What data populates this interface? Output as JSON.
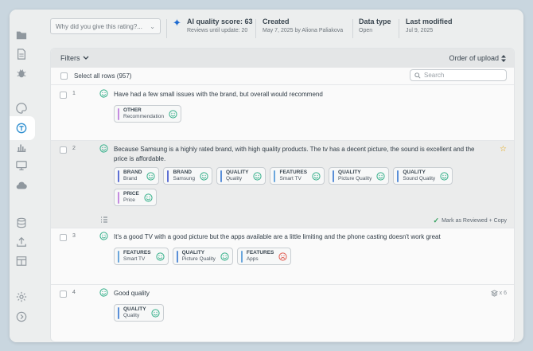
{
  "header": {
    "rating_placeholder": "Why did you give this rating?...",
    "ai_score_label": "AI quality score: 63",
    "ai_score_sub": "Reviews until update: 20",
    "created_label": "Created",
    "created_value": "May 7, 2025 by Aliona Paliakova",
    "data_type_label": "Data type",
    "data_type_value": "Open",
    "modified_label": "Last modified",
    "modified_value": "Jul 9, 2025"
  },
  "toolbar": {
    "filters_label": "Filters",
    "order_label": "Order of upload",
    "select_all_label": "Select all rows (957)",
    "search_placeholder": "Search"
  },
  "sidebar": {
    "items": [
      "folder-icon",
      "document-icon",
      "bug-icon",
      "palette-icon",
      "text-analysis-icon",
      "bar-chart-icon",
      "monitor-icon",
      "cloud-icon",
      "database-icon",
      "upload-icon",
      "table-icon",
      "settings-icon",
      "expand-icon"
    ],
    "active_index": 4
  },
  "colors": {
    "positive": "#35b08a",
    "negative": "#e05a4f",
    "bar_other": "#c48ce0",
    "bar_brand": "#5d6fd4",
    "bar_quality": "#5a8fd8",
    "bar_features": "#6aa6dc",
    "bar_price": "#c48ce0",
    "star": "#e5a200",
    "accent": "#2f8fd0"
  },
  "rows": [
    {
      "num": "1",
      "text": "Have had a few small issues with the brand, but overall would recommend",
      "tags": [
        {
          "cat": "OTHER",
          "sub": "Recommendation",
          "sentiment": "positive"
        }
      ]
    },
    {
      "num": "2",
      "text": "Because Samsung is a highly rated brand, with high quality products. The tv has a decent picture, the sound is excellent and the price is affordable.",
      "tags": [
        {
          "cat": "BRAND",
          "sub": "Brand",
          "sentiment": "positive"
        },
        {
          "cat": "BRAND",
          "sub": "Samsung",
          "sentiment": "positive"
        },
        {
          "cat": "QUALITY",
          "sub": "Quality",
          "sentiment": "positive"
        },
        {
          "cat": "FEATURES",
          "sub": "Smart TV",
          "sentiment": "positive"
        },
        {
          "cat": "QUALITY",
          "sub": "Picture Quality",
          "sentiment": "positive"
        },
        {
          "cat": "QUALITY",
          "sub": "Sound Quality",
          "sentiment": "positive"
        },
        {
          "cat": "PRICE",
          "sub": "Price",
          "sentiment": "positive"
        }
      ],
      "action_label": "Mark as Reviewed + Copy"
    },
    {
      "num": "3",
      "text": "It's a good TV with a good picture but the apps available are a little limiting and the phone casting doesn't work great",
      "tags": [
        {
          "cat": "FEATURES",
          "sub": "Smart TV",
          "sentiment": "positive"
        },
        {
          "cat": "QUALITY",
          "sub": "Picture Quality",
          "sentiment": "positive"
        },
        {
          "cat": "FEATURES",
          "sub": "Apps",
          "sentiment": "negative"
        }
      ]
    },
    {
      "num": "4",
      "text": "Good quality",
      "tags": [
        {
          "cat": "QUALITY",
          "sub": "Quality",
          "sentiment": "positive"
        }
      ],
      "dupes": "x 6"
    }
  ]
}
